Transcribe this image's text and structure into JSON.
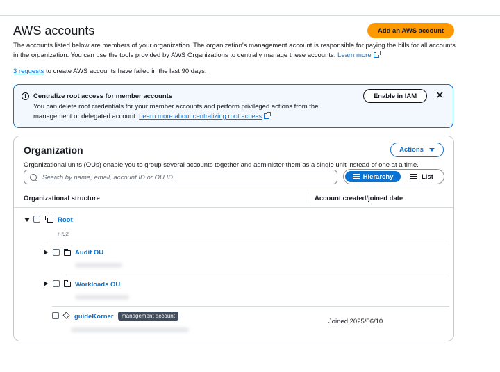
{
  "header": {
    "title": "AWS accounts",
    "add_account_label": "Add an AWS account",
    "intro_text": "The accounts listed below are members of your organization. The organization's management account is responsible for paying the bills for all accounts in the organization. You can use the tools provided by AWS Organizations to centrally manage these accounts.",
    "learn_more_label": "Learn more",
    "requests_link": "3 requests",
    "requests_text": " to create AWS accounts have failed in the last 90 days."
  },
  "alert": {
    "icon": "info-icon",
    "title": "Centralize root access for member accounts",
    "body": "You can delete root credentials for your member accounts and perform privileged actions from the management or delegated account.",
    "link_label": "Learn more about centralizing root access",
    "enable_label": "Enable in IAM",
    "close_icon": "close-icon"
  },
  "organization": {
    "title": "Organization",
    "actions_label": "Actions",
    "description": "Organizational units (OUs) enable you to group several accounts together and administer them as a single unit instead of one at a time.",
    "search_placeholder": "Search by name, email, account ID or OU ID.",
    "view_toggle": {
      "hierarchy_label": "Hierarchy",
      "list_label": "List",
      "selected": "Hierarchy"
    },
    "columns": [
      "Organizational structure",
      "Account created/joined date"
    ],
    "tree": {
      "root": {
        "label": "Root",
        "sub": "r-l92",
        "expanded": true
      },
      "ous": [
        {
          "label": "Audit OU",
          "expanded": false
        },
        {
          "label": "Workloads OU",
          "expanded": false
        }
      ],
      "account": {
        "label": "guideKorner",
        "badge": "management account",
        "joined": "Joined 2025/06/10"
      }
    }
  },
  "colors": {
    "accent": "#0972d3",
    "primary_button": "#ff9900",
    "alert_bg": "#f2f8fd",
    "badge_bg": "#414d5c"
  }
}
